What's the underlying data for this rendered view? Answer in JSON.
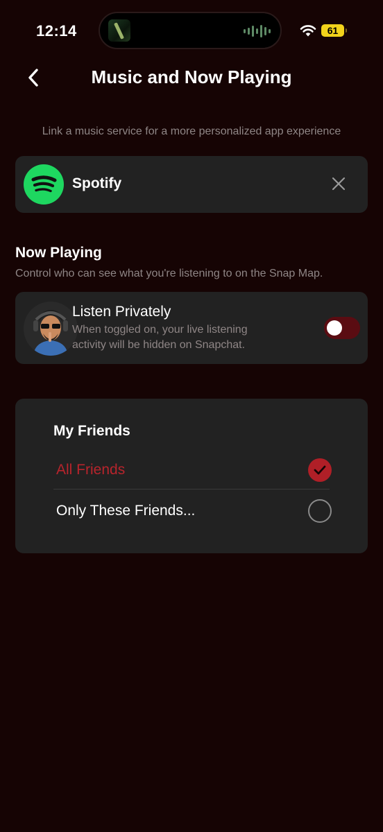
{
  "status_bar": {
    "time": "12:14",
    "battery": "61",
    "battery_color": "#f2d31b"
  },
  "header": {
    "title": "Music and Now Playing",
    "back_icon": "chevron-left-icon"
  },
  "subtitle": "Link a music service for a more personalized app experience",
  "spotify": {
    "name": "Spotify",
    "logo_icon": "spotify-icon",
    "brand_color": "#1ed760",
    "close_icon": "close-icon"
  },
  "now_playing": {
    "title": "Now Playing",
    "description": "Control who can see what you're listening to on the Snap Map.",
    "listen_privately": {
      "title": "Listen Privately",
      "description": "When toggled on, your live listening activity will be hidden on Snapchat.",
      "toggled": false
    }
  },
  "friends": {
    "title": "My Friends",
    "options": [
      {
        "label": "All Friends",
        "selected": true
      },
      {
        "label": "Only These Friends...",
        "selected": false
      }
    ],
    "accent_color": "#b01f27"
  }
}
